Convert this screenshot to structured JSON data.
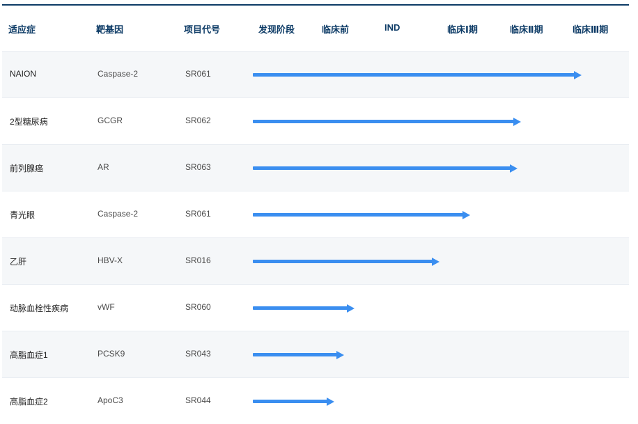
{
  "header": {
    "indication": "适应症",
    "target": "靶基因",
    "project": "项目代号",
    "stages": [
      "发现阶段",
      "临床前",
      "IND",
      "临床Ⅰ期",
      "临床Ⅱ期",
      "临床Ⅲ期"
    ]
  },
  "rows": [
    {
      "indication": "NAION",
      "target": "Caspase-2",
      "code": "SR061",
      "progress": 0.97
    },
    {
      "indication": "2型糖尿病",
      "target": "GCGR",
      "code": "SR062",
      "progress": 0.79
    },
    {
      "indication": "前列腺癌",
      "target": "AR",
      "code": "SR063",
      "progress": 0.78
    },
    {
      "indication": "青光眼",
      "target": "Caspase-2",
      "code": "SR061",
      "progress": 0.64
    },
    {
      "indication": "乙肝",
      "target": "HBV-X",
      "code": "SR016",
      "progress": 0.55
    },
    {
      "indication": "动脉血栓性疾病",
      "target": "vWF",
      "code": "SR060",
      "progress": 0.3
    },
    {
      "indication": "高脂血症1",
      "target": "PCSK9",
      "code": "SR043",
      "progress": 0.27
    },
    {
      "indication": "高脂血症2",
      "target": "ApoC3",
      "code": "SR044",
      "progress": 0.24
    }
  ],
  "colors": {
    "arrow": "#3a8ef0",
    "header_text": "#0d3b66",
    "row_alt": "#f5f7f9"
  }
}
